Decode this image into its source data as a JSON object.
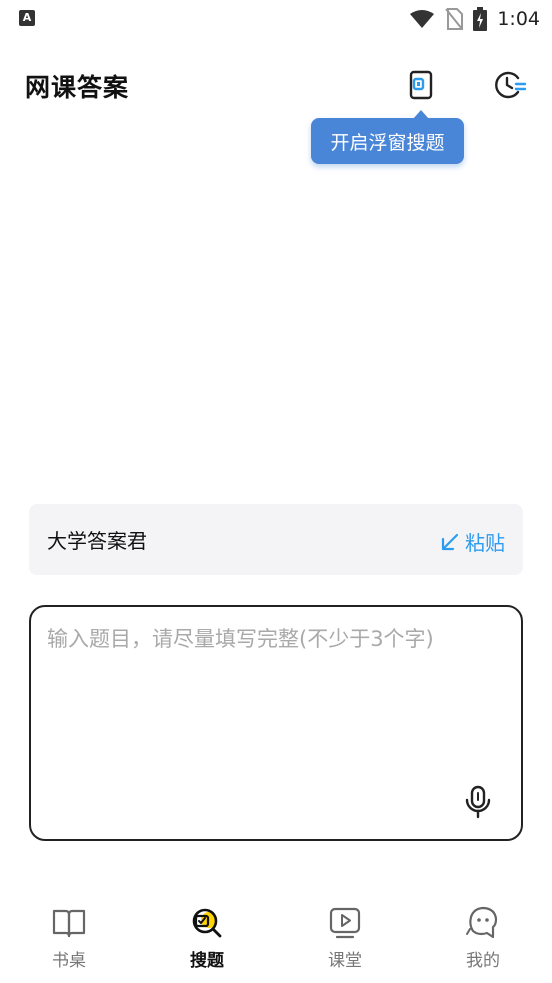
{
  "status_bar": {
    "time": "1:04",
    "app_icon_letter": "A"
  },
  "header": {
    "title": "网课答案",
    "float_icon": "floating-window-icon",
    "history_icon": "history-icon"
  },
  "tooltip": {
    "text": "开启浮窗搜题"
  },
  "clipboard": {
    "text": "大学答案君",
    "paste_label": "粘贴",
    "paste_icon": "arrow-down-left-icon"
  },
  "input": {
    "value": "",
    "placeholder": "输入题目，请尽量填写完整(不少于3个字)",
    "mic_icon": "microphone-icon"
  },
  "nav": {
    "items": [
      {
        "label": "书桌",
        "icon": "book-icon"
      },
      {
        "label": "搜题",
        "icon": "search-question-icon"
      },
      {
        "label": "课堂",
        "icon": "play-classroom-icon"
      },
      {
        "label": "我的",
        "icon": "profile-icon"
      }
    ],
    "active_index": 1
  },
  "colors": {
    "accent": "#2c9cf0",
    "tooltip_bg": "#4a86d8",
    "active_nav_highlight": "#ffd400"
  }
}
